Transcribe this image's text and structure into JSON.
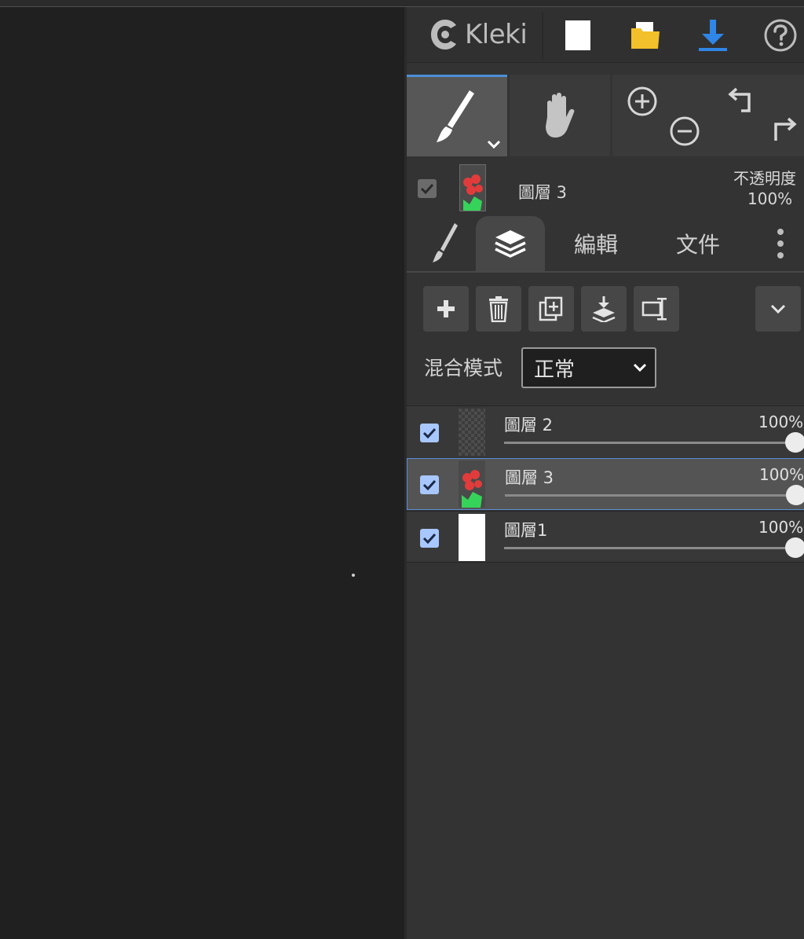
{
  "header": {
    "logo_text": "Kleki",
    "new_icon": "new-document-icon",
    "open_icon": "folder-open-icon",
    "download_icon": "download-icon",
    "help_icon": "help-icon"
  },
  "tools": {
    "brush_icon": "brush-icon",
    "hand_icon": "hand-icon",
    "zoom_in_icon": "zoom-in-icon",
    "zoom_out_icon": "zoom-out-icon",
    "undo_icon": "undo-icon",
    "redo_icon": "redo-icon"
  },
  "current_layer": {
    "name": "圖層 3",
    "opacity_label": "不透明度",
    "opacity_value": "100%"
  },
  "tabs": {
    "edit": "編輯",
    "file": "文件"
  },
  "blend": {
    "label": "混合模式",
    "value": "正常"
  },
  "layers": [
    {
      "name": "圖層 2",
      "opacity": "100%",
      "checked": true,
      "selected": false
    },
    {
      "name": "圖層 3",
      "opacity": "100%",
      "checked": true,
      "selected": true
    },
    {
      "name": "圖層1",
      "opacity": "100%",
      "checked": true,
      "selected": false
    }
  ],
  "colors": {
    "accent": "#4c8fd8",
    "download": "#2f86e6",
    "folder": "#f2c02a",
    "checkbox": "#a8c7ff"
  }
}
